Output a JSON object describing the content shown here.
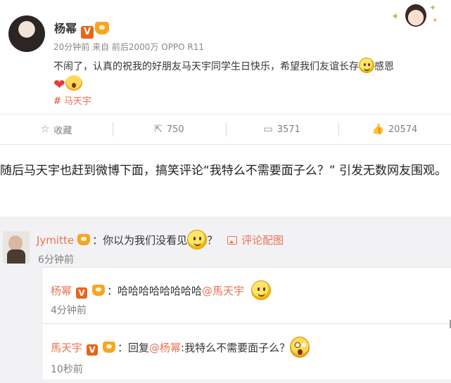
{
  "post": {
    "author": "杨幂",
    "verified_badge": "V",
    "meta": "20分钟前  来自 前后2000万 OPPO R11",
    "text_before_emoji": "不闹了，认真的祝我的好朋友马天宇同学生日快乐，希望我们友谊长存",
    "text_after_emoji": "感恩",
    "topic": "马天宇",
    "topic_symbol": "#",
    "icons": [
      "smile-emoji",
      "heart-emoji",
      "shock-emoji",
      "sticker-girl"
    ]
  },
  "actions": [
    {
      "icon": "star-icon",
      "label": "收藏"
    },
    {
      "icon": "share-icon",
      "label": "750"
    },
    {
      "icon": "comment-icon",
      "label": "3571"
    },
    {
      "icon": "like-icon",
      "label": "20574"
    }
  ],
  "article": {
    "paragraph": "随后马天宇也赶到微博下面，搞笑评论“我特么不需要面子么？”  引发无数网友围观。"
  },
  "comment": {
    "user": "Jymitte",
    "text_before": "：你以为我们没看见",
    "text_after": "？",
    "pic_link": "评论配图",
    "time": "6分钟前"
  },
  "replies": [
    {
      "user": "杨幂",
      "badge": "V",
      "text": "：哈哈哈哈哈哈哈哈",
      "mention": "@馬天宇",
      "time": "4分钟前"
    },
    {
      "user": "馬天宇",
      "badge": "V",
      "text_prefix": "：回复",
      "mention": "@杨幂",
      "text": ":我特么不需要面子么？",
      "time": "10秒前"
    }
  ],
  "colors": {
    "accent": "#eb7350",
    "meta_text": "#888888",
    "comment_bg": "#f2f2f5",
    "vip_badge": "#e8651a"
  }
}
